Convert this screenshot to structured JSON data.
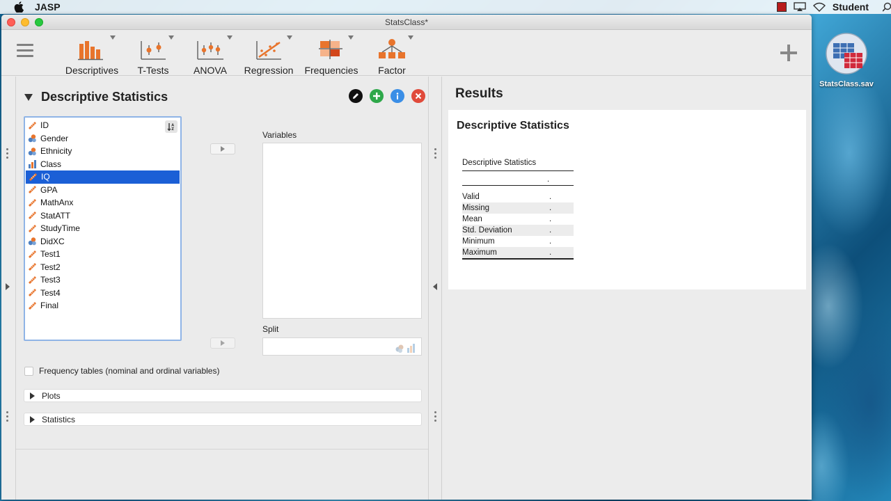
{
  "menubar": {
    "app_name": "JASP",
    "user": "Student"
  },
  "window": {
    "title": "StatsClass*"
  },
  "toolbar": {
    "items": [
      {
        "label": "Descriptives",
        "icon": "descriptives-icon"
      },
      {
        "label": "T-Tests",
        "icon": "t-tests-icon"
      },
      {
        "label": "ANOVA",
        "icon": "anova-icon"
      },
      {
        "label": "Regression",
        "icon": "regression-icon"
      },
      {
        "label": "Frequencies",
        "icon": "frequencies-icon"
      },
      {
        "label": "Factor",
        "icon": "factor-icon"
      }
    ]
  },
  "analysis": {
    "title": "Descriptive Statistics",
    "variables": [
      {
        "name": "ID",
        "type": "scale"
      },
      {
        "name": "Gender",
        "type": "nominal"
      },
      {
        "name": "Ethnicity",
        "type": "nominal"
      },
      {
        "name": "Class",
        "type": "ordinal"
      },
      {
        "name": "IQ",
        "type": "scale",
        "selected": true
      },
      {
        "name": "GPA",
        "type": "scale"
      },
      {
        "name": "MathAnx",
        "type": "scale"
      },
      {
        "name": "StatATT",
        "type": "scale"
      },
      {
        "name": "StudyTime",
        "type": "scale"
      },
      {
        "name": "DidXC",
        "type": "nominal"
      },
      {
        "name": "Test1",
        "type": "scale"
      },
      {
        "name": "Test2",
        "type": "scale"
      },
      {
        "name": "Test3",
        "type": "scale"
      },
      {
        "name": "Test4",
        "type": "scale"
      },
      {
        "name": "Final",
        "type": "scale"
      }
    ],
    "variables_label": "Variables",
    "split_label": "Split",
    "frequency_tables_label": "Frequency tables (nominal and ordinal variables)",
    "plots_label": "Plots",
    "statistics_label": "Statistics"
  },
  "results": {
    "heading": "Results",
    "card_title": "Descriptive Statistics",
    "table": {
      "caption": "Descriptive Statistics",
      "header_value": ".",
      "rows": [
        {
          "label": "Valid",
          "value": "."
        },
        {
          "label": "Missing",
          "value": "."
        },
        {
          "label": "Mean",
          "value": "."
        },
        {
          "label": "Std. Deviation",
          "value": "."
        },
        {
          "label": "Minimum",
          "value": "."
        },
        {
          "label": "Maximum",
          "value": "."
        }
      ]
    }
  },
  "desktop": {
    "file_label": "StatsClass.sav"
  },
  "colors": {
    "selection": "#1b5fd6",
    "accent_orange": "#e8742c",
    "edit_black": "#111111",
    "add_green": "#2ea84a",
    "info_blue": "#3a8ee6",
    "close_red": "#e04a3a"
  }
}
